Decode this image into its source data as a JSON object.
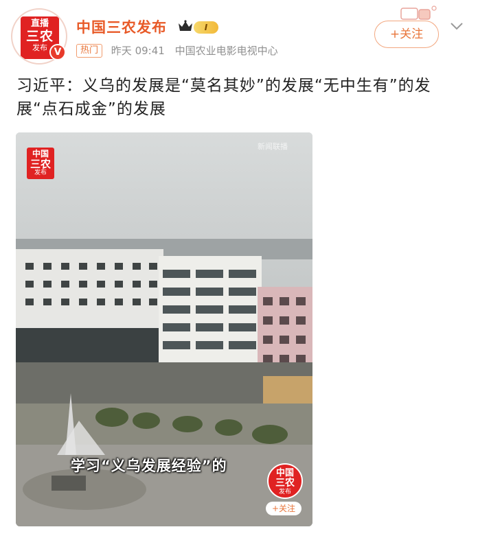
{
  "header": {
    "avatar": {
      "badge_top": "直播",
      "badge_big": "三农",
      "badge_small": "发布",
      "verified_mark": "V"
    },
    "account_name": "中国三农发布",
    "level_badge": "I",
    "crown_icon": "crown-icon",
    "tag": "热门",
    "time": "昨天 09:41",
    "source": "中国农业电影电视中心",
    "follow_label": "+关注",
    "more_icon": "chevron-down-icon"
  },
  "post": {
    "text": "习近平：义乌的发展是“莫名其妙”的发展“无中生有”的发展“点石成金”的发展"
  },
  "video": {
    "watermark_logo": {
      "top": "中国",
      "mid": "三农",
      "bottom": "发布"
    },
    "watermark_right": "新闻联播",
    "caption": "学习“义乌发展经验”的",
    "corner_logo": {
      "top": "中国",
      "mid": "三农",
      "bottom": "发布"
    },
    "corner_follow": "+关注"
  },
  "colors": {
    "brand": "#e85a28",
    "logo_red": "#e02222",
    "meta_gray": "#8f8f8f"
  }
}
